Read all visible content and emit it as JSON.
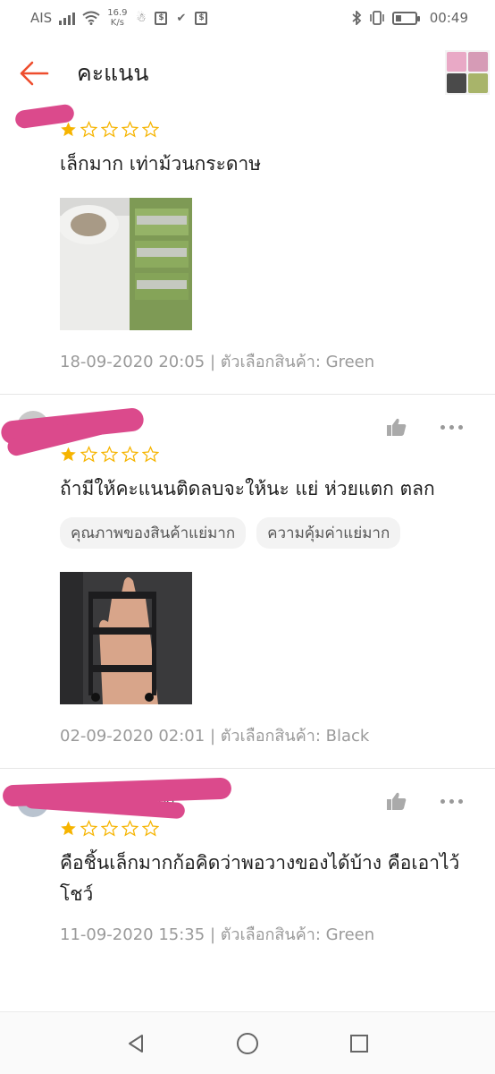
{
  "status_bar": {
    "carrier": "AIS",
    "speed_value": "16.9",
    "speed_unit": "K/s",
    "time": "00:49",
    "battery_level": 0.3
  },
  "header": {
    "title": "คะแนน"
  },
  "reviews": [
    {
      "username": "",
      "rating": 1,
      "max_rating": 5,
      "text": "เล็กมาก เท่าม้วนกระดาษ",
      "tags": [],
      "date": "18-09-2020 20:05",
      "variant_label": "ตัวเลือกสินค้า: Green",
      "has_actions": false
    },
    {
      "username": "ธ",
      "rating": 1,
      "max_rating": 5,
      "text": "ถ้ามีให้คะแนนติดลบจะให้นะ แย่ ห่วยแตก ตลก",
      "tags": [
        "คุณภาพของสินค้าแย่มาก",
        "ความคุ้มค่าแย่มาก"
      ],
      "date": "02-09-2020 02:01",
      "variant_label": "ตัวเลือกสินค้า: Black",
      "has_actions": true
    },
    {
      "username": "od",
      "rating": 1,
      "max_rating": 5,
      "text": "คือชิ้นเล็กมากก้อคิดว่าพอวางของได้บ้าง คือเอาไว้โชว์",
      "tags": [],
      "date": "11-09-2020 15:35",
      "variant_label": "ตัวเลือกสินค้า: Green",
      "has_actions": true
    }
  ],
  "colors": {
    "accent": "#ee4d2d",
    "star_filled": "#f6b400",
    "star_empty": "#f6b400",
    "redaction": "#db4a8c"
  },
  "icons": {
    "back": "arrow-left-icon",
    "like": "thumbs-up-icon",
    "more": "more-dots-icon",
    "nav_back": "triangle-back-icon",
    "nav_home": "circle-home-icon",
    "nav_recents": "square-recents-icon"
  }
}
